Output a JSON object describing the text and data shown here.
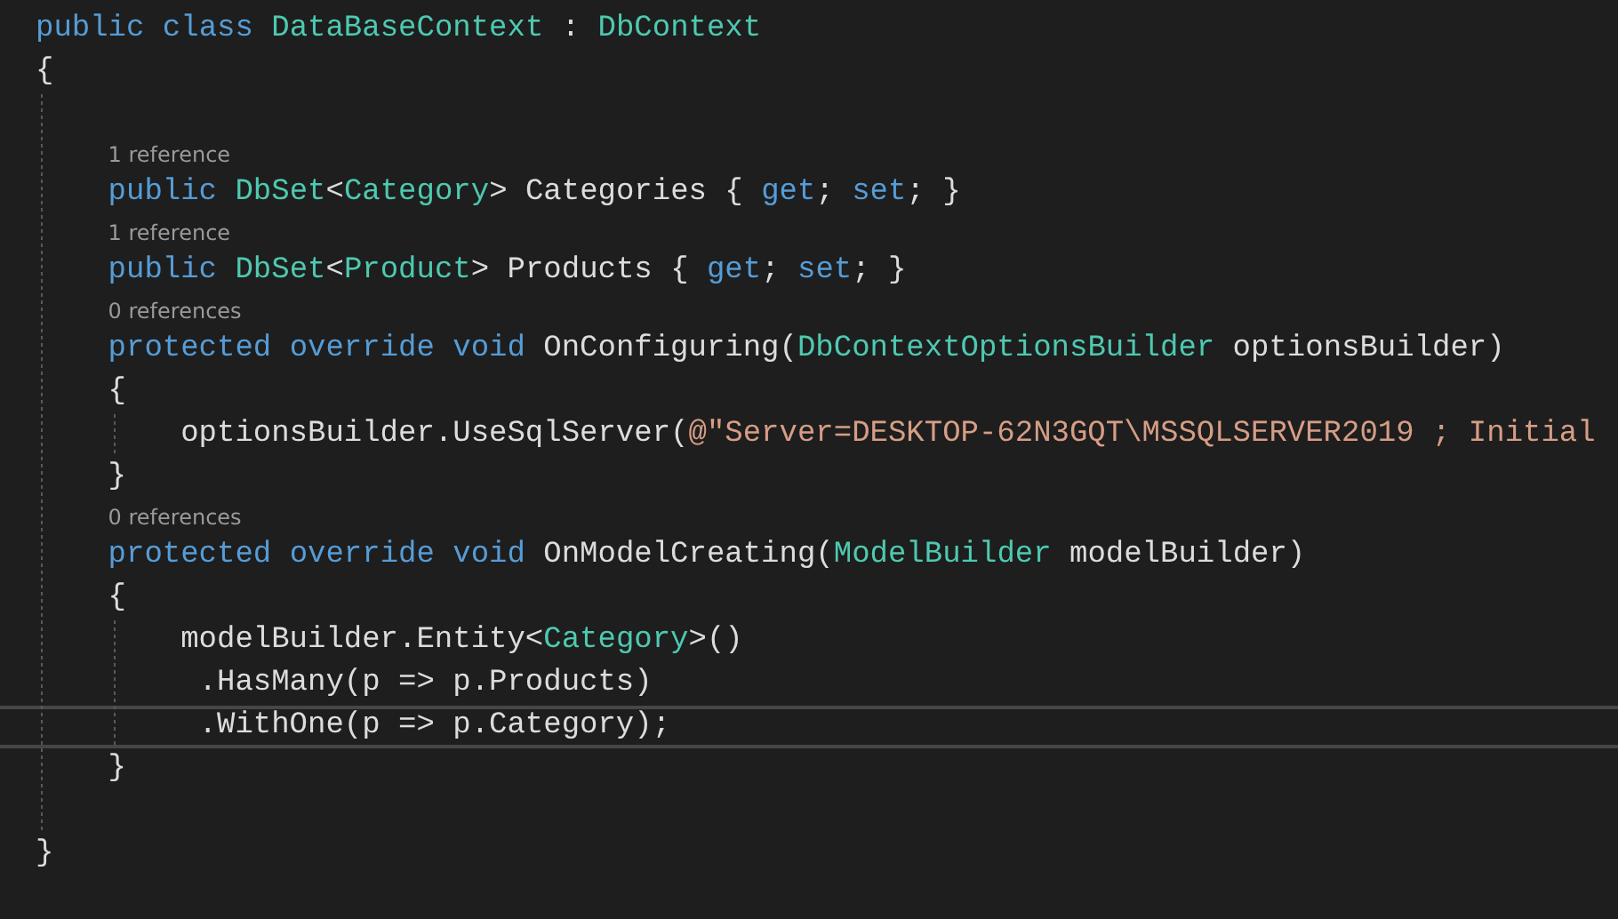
{
  "editor": {
    "lines": [
      {
        "kind": "code",
        "selected": false,
        "tokens": [
          {
            "kind": "kw",
            "t": "public class "
          },
          {
            "kind": "type",
            "t": "DataBaseContext"
          },
          {
            "kind": "plain",
            "t": " : "
          },
          {
            "kind": "type",
            "t": "DbContext"
          }
        ]
      },
      {
        "kind": "code",
        "selected": false,
        "tokens": [
          {
            "kind": "plain",
            "t": "{"
          }
        ],
        "children": [
          {
            "kind": "blank",
            "selected": false
          },
          {
            "kind": "lens",
            "selected": false,
            "text": "1 reference"
          },
          {
            "kind": "code",
            "selected": false,
            "tokens": [
              {
                "kind": "kw",
                "t": "public "
              },
              {
                "kind": "type",
                "t": "DbSet"
              },
              {
                "kind": "plain",
                "t": "<"
              },
              {
                "kind": "type",
                "t": "Category"
              },
              {
                "kind": "plain",
                "t": "> Categories { "
              },
              {
                "kind": "kw",
                "t": "get"
              },
              {
                "kind": "plain",
                "t": "; "
              },
              {
                "kind": "kw",
                "t": "set"
              },
              {
                "kind": "plain",
                "t": "; }"
              }
            ]
          },
          {
            "kind": "lens",
            "selected": false,
            "text": "1 reference"
          },
          {
            "kind": "code",
            "selected": false,
            "tokens": [
              {
                "kind": "kw",
                "t": "public "
              },
              {
                "kind": "type",
                "t": "DbSet"
              },
              {
                "kind": "plain",
                "t": "<"
              },
              {
                "kind": "type",
                "t": "Product"
              },
              {
                "kind": "plain",
                "t": "> Products { "
              },
              {
                "kind": "kw",
                "t": "get"
              },
              {
                "kind": "plain",
                "t": "; "
              },
              {
                "kind": "kw",
                "t": "set"
              },
              {
                "kind": "plain",
                "t": "; }"
              }
            ]
          },
          {
            "kind": "lens",
            "selected": false,
            "text": "0 references"
          },
          {
            "kind": "code",
            "selected": false,
            "tokens": [
              {
                "kind": "kw",
                "t": "protected override void "
              },
              {
                "kind": "plain",
                "t": "OnConfiguring("
              },
              {
                "kind": "type",
                "t": "DbContextOptionsBuilder"
              },
              {
                "kind": "plain",
                "t": " optionsBuilder)"
              }
            ]
          },
          {
            "kind": "code",
            "selected": false,
            "tokens": [
              {
                "kind": "plain",
                "t": "{"
              }
            ],
            "children": [
              {
                "kind": "code",
                "selected": false,
                "tokens": [
                  {
                    "kind": "plain",
                    "t": "optionsBuilder.UseSqlServer("
                  },
                  {
                    "kind": "str",
                    "t": "@\"Server=DESKTOP-62N3GQT\\MSSQLSERVER2019 ; Initial"
                  }
                ]
              }
            ]
          },
          {
            "kind": "code",
            "selected": false,
            "tokens": [
              {
                "kind": "plain",
                "t": "}"
              }
            ]
          },
          {
            "kind": "lens",
            "selected": false,
            "text": "0 references"
          },
          {
            "kind": "code",
            "selected": false,
            "tokens": [
              {
                "kind": "kw",
                "t": "protected override void "
              },
              {
                "kind": "plain",
                "t": "OnModelCreating("
              },
              {
                "kind": "type",
                "t": "ModelBuilder"
              },
              {
                "kind": "plain",
                "t": " modelBuilder)"
              }
            ]
          },
          {
            "kind": "code",
            "selected": false,
            "tokens": [
              {
                "kind": "plain",
                "t": "{"
              }
            ],
            "children": [
              {
                "kind": "code",
                "selected": false,
                "tokens": [
                  {
                    "kind": "plain",
                    "t": "modelBuilder.Entity<"
                  },
                  {
                    "kind": "type",
                    "t": "Category"
                  },
                  {
                    "kind": "plain",
                    "t": ">()"
                  }
                ]
              },
              {
                "kind": "code",
                "selected": false,
                "tokens": [
                  {
                    "kind": "plain",
                    "t": " .HasMany(p => p.Products)"
                  }
                ]
              },
              {
                "kind": "code",
                "selected": true,
                "tokens": [
                  {
                    "kind": "plain",
                    "t": " .WithOne(p => p.Category);"
                  }
                ]
              }
            ]
          },
          {
            "kind": "code",
            "selected": false,
            "tokens": [
              {
                "kind": "plain",
                "t": "}"
              }
            ]
          },
          {
            "kind": "blank",
            "selected": false
          }
        ]
      },
      {
        "kind": "code",
        "selected": false,
        "tokens": [
          {
            "kind": "plain",
            "t": "}"
          }
        ]
      }
    ]
  }
}
